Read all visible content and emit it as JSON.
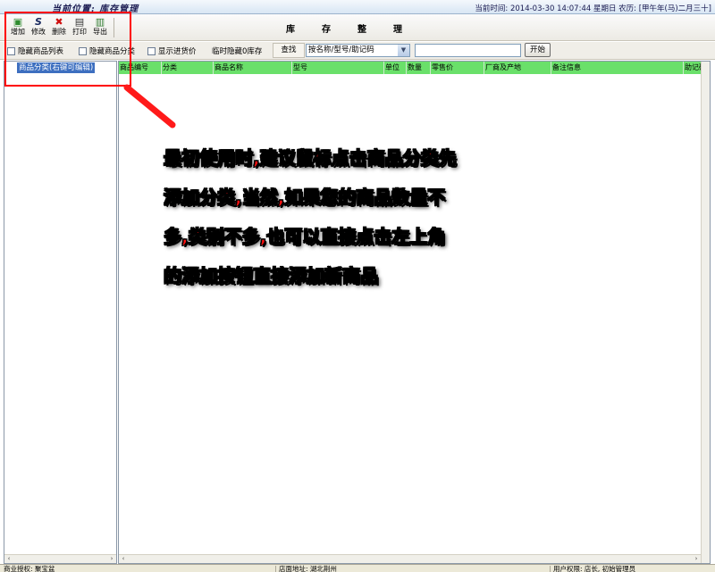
{
  "header": {
    "location": "当前位置: 库存管理",
    "datetime": "当前时间: 2014-03-30 14:07:44 星期日 农历: [甲午年(马)二月三十]"
  },
  "toolbar": {
    "buttons": [
      {
        "label": "增加",
        "icon": "add-icon",
        "glyph": "▣"
      },
      {
        "label": "修改",
        "icon": "edit-icon",
        "glyph": "S"
      },
      {
        "label": "删除",
        "icon": "delete-icon",
        "glyph": "✖"
      },
      {
        "label": "打印",
        "icon": "print-icon",
        "glyph": "▤"
      },
      {
        "label": "导出",
        "icon": "export-icon",
        "glyph": "▥"
      }
    ],
    "title": "库存整理"
  },
  "filters": {
    "checkboxes": [
      "隐藏商品列表",
      "隐藏商品分类",
      "显示进货价"
    ],
    "temp_hide": "临时隐藏0库存",
    "find_label": "查找",
    "select_value": "按名称/型号/助记码",
    "search_value": "",
    "start_label": "开始"
  },
  "tree": {
    "root": "商品分类(右键可编辑)"
  },
  "grid": {
    "columns": [
      "商品编号",
      "分类",
      "商品名称",
      "型号",
      "单位",
      "数量",
      "零售价",
      "厂商及产地",
      "备注信息",
      "助记码"
    ]
  },
  "status": {
    "license": "商业授权: 聚宝盆",
    "address": "店面地址: 湖北荆州",
    "role": "用户权限: 店长, 初始管理员"
  },
  "annotation": {
    "lines": [
      "最初使用时,建议鼠标点击商品分类先",
      "添加分类,当然,如果您的商品数量不",
      "多,类别不多,也可以直接点击左上角",
      "的添加按钮直接添加新商品"
    ]
  },
  "colors": {
    "grid_header": "#6ae06a",
    "annotation_text": "#ff1010",
    "highlight": "#ff0000",
    "tree_selected": "#3d6fc0"
  }
}
